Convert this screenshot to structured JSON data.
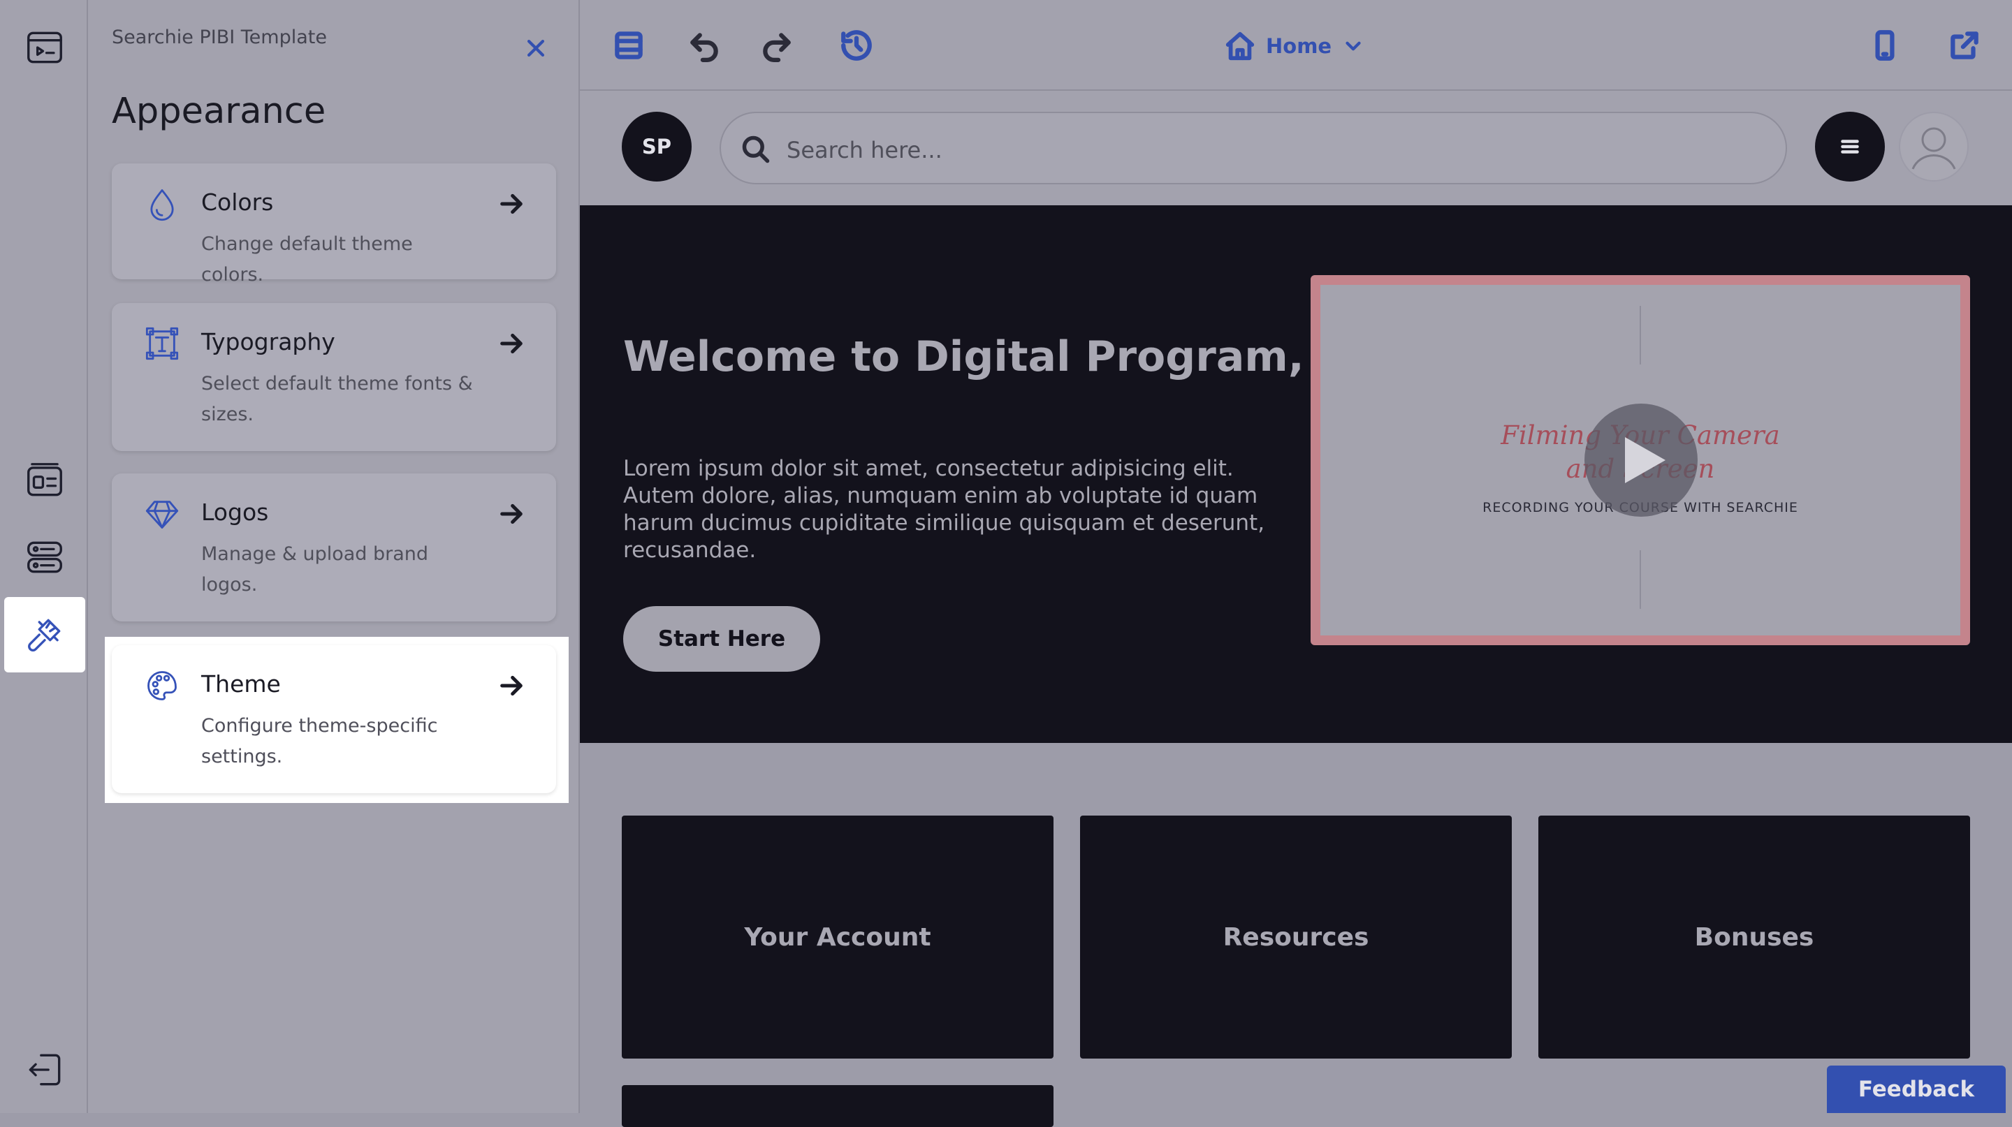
{
  "panel": {
    "template_name": "Searchie PIBI Template",
    "title": "Appearance",
    "cards": [
      {
        "title": "Colors",
        "desc": "Change default theme colors.",
        "icon": "droplet-icon"
      },
      {
        "title": "Typography",
        "desc": "Select default theme fonts & sizes.",
        "icon": "text-box-icon"
      },
      {
        "title": "Logos",
        "desc": "Manage & upload brand logos.",
        "icon": "diamond-icon"
      },
      {
        "title": "Theme",
        "desc": "Configure theme-specific settings.",
        "icon": "palette-icon"
      }
    ]
  },
  "toolbar": {
    "page_select": "Home"
  },
  "site": {
    "avatar_initials": "SP",
    "search_placeholder": "Search here...",
    "hero_title": "Welcome to Digital Program, Will",
    "hero_text": "Lorem ipsum dolor sit amet, consectetur adipisicing elit. Autem dolore, alias, numquam enim ab voluptate id quam harum ducimus cupiditate similique quisquam et deserunt, recusandae.",
    "start_button": "Start Here",
    "video_title_line1": "Filming Your Camera",
    "video_title_line2": "and Screen",
    "video_subtitle": "RECORDING YOUR COURSE WITH SEARCHIE",
    "tiles": [
      "Your Account",
      "Resources",
      "Bonuses"
    ]
  },
  "feedback": "Feedback",
  "colors": {
    "accent": "#3350b0",
    "overlay": "#9d9ca9",
    "dark": "#13121c",
    "video_border": "#c4848c"
  }
}
